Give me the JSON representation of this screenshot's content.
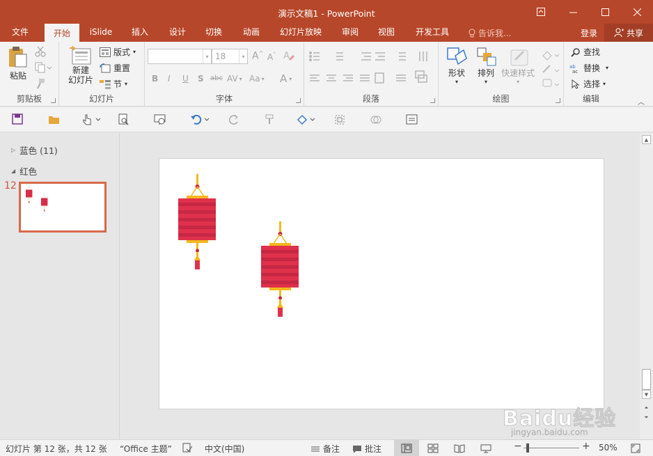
{
  "window": {
    "title": "演示文稿1 - PowerPoint"
  },
  "tabs": [
    {
      "label": "文件",
      "active": false
    },
    {
      "label": "开始",
      "active": true
    },
    {
      "label": "iSlide",
      "active": false
    },
    {
      "label": "插入",
      "active": false
    },
    {
      "label": "设计",
      "active": false
    },
    {
      "label": "切换",
      "active": false
    },
    {
      "label": "动画",
      "active": false
    },
    {
      "label": "幻灯片放映",
      "active": false
    },
    {
      "label": "审阅",
      "active": false
    },
    {
      "label": "视图",
      "active": false
    },
    {
      "label": "开发工具",
      "active": false
    }
  ],
  "tell_me": "告诉我...",
  "login": "登录",
  "share": "共享",
  "ribbon": {
    "clipboard": {
      "label": "剪贴板",
      "paste": "粘贴"
    },
    "slides": {
      "label": "幻灯片",
      "new_slide_line1": "新建",
      "new_slide_line2": "幻灯片",
      "layout": "版式",
      "reset": "重置",
      "section": "节"
    },
    "font": {
      "label": "字体",
      "font_size": "18",
      "bold": "B",
      "italic": "I",
      "underline": "U",
      "shadow": "S",
      "strike": "abc",
      "spacing": "AV",
      "case": "Aa",
      "color": "A"
    },
    "paragraph": {
      "label": "段落"
    },
    "drawing": {
      "label": "绘图",
      "shapes": "形状",
      "arrange": "排列",
      "quick_styles": "快速样式"
    },
    "editing": {
      "label": "编辑",
      "find": "查找",
      "replace": "替换",
      "select": "选择"
    }
  },
  "sections": [
    {
      "name": "蓝色 (11)",
      "expanded": false
    },
    {
      "name": "红色",
      "expanded": true
    }
  ],
  "thumbnail": {
    "number": "12"
  },
  "status": {
    "slide_info": "幻灯片 第 12 张，共 12 张",
    "theme": "“Office 主题”",
    "language": "中文(中国)",
    "notes": "备注",
    "comments": "批注",
    "zoom": "50%",
    "zoom_minus": "−",
    "zoom_plus": "+"
  },
  "watermark": {
    "brand": "Baidu经验",
    "site": "jingyan.baidu.com"
  },
  "colors": {
    "accent": "#b7472a",
    "lantern_red": "#e0314b",
    "lantern_stripe": "#c62844",
    "lantern_gold": "#f5b81c"
  }
}
